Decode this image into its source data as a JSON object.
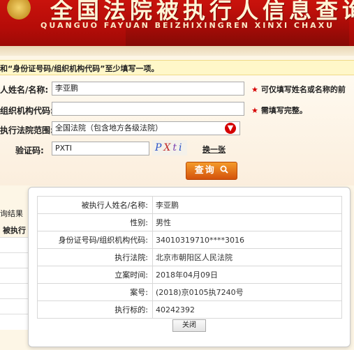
{
  "header": {
    "title": "全国法院被执行人信息查询",
    "subtitle": "QUANGUO FAYUAN BEIZHIXINGREN XINXI CHAXU"
  },
  "notice": "和“身份证号码/组织机构代码”至少填写一项。",
  "form": {
    "name_label": "人姓名/名称:",
    "name_value": "李亚鹏",
    "name_hint_star": "★",
    "name_hint": "可仅填写姓名或名称的前",
    "org_label": "组织机构代码:",
    "org_value": "",
    "org_hint_star": "★",
    "org_hint": "需填写完整。",
    "court_label": "执行法院范围:",
    "court_value": "全国法院（包含地方各级法院）",
    "captcha_label": "验证码:",
    "captcha_value": "PXTI",
    "captcha_chars": [
      "P",
      "X",
      "t",
      "i"
    ],
    "refresh_label": "换一张",
    "query_label": "查询",
    "query_icon": "magnifier-icon"
  },
  "behind": {
    "results_label": "询结果",
    "col_label": "被执行"
  },
  "popup": {
    "rows": [
      {
        "key": "被执行人姓名/名称:",
        "value": "李亚鹏"
      },
      {
        "key": "性别:",
        "value": "男性"
      },
      {
        "key": "身份证号码/组织机构代码:",
        "value": "34010319710****3016"
      },
      {
        "key": "执行法院:",
        "value": "北京市朝阳区人民法院"
      },
      {
        "key": "立案时间:",
        "value": "2018年04月09日"
      },
      {
        "key": "案号:",
        "value": "(2018)京0105执7240号"
      },
      {
        "key": "执行标的:",
        "value": "40242392"
      }
    ],
    "close_label": "关闭"
  },
  "colors": {
    "banner_red": "#b50c08",
    "accent_orange": "#e0701a",
    "required_star": "#d60000"
  }
}
